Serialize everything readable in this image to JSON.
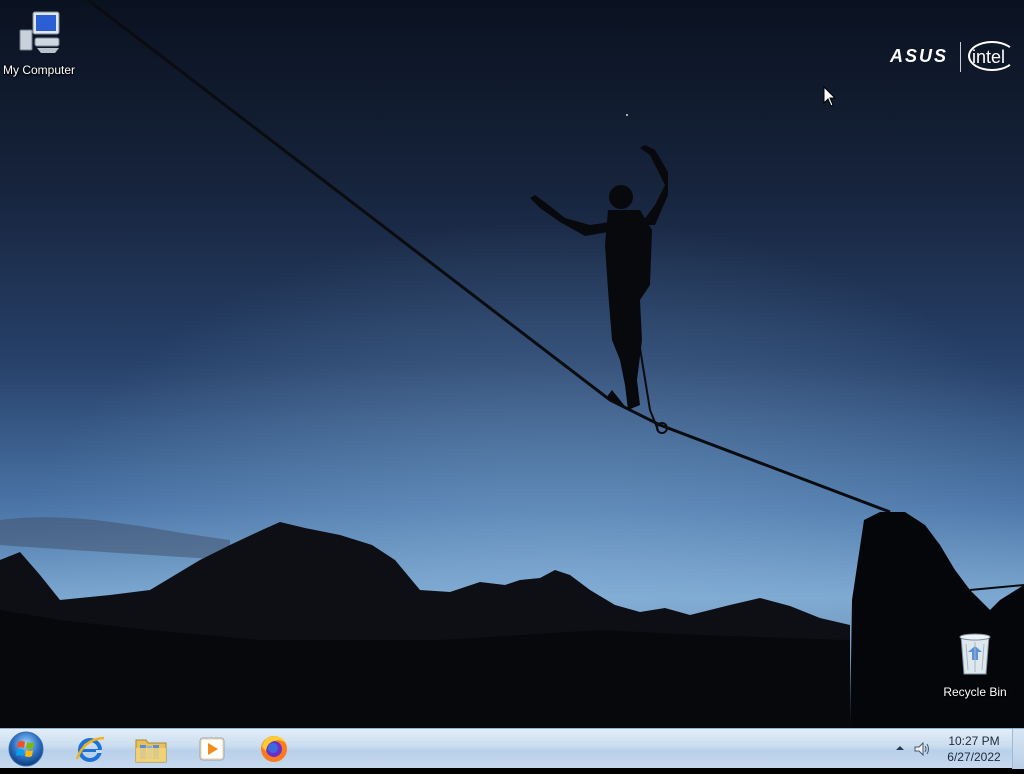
{
  "desktop": {
    "icons": [
      {
        "label": "My Computer",
        "icon": "computer-icon"
      },
      {
        "label": "Recycle Bin",
        "icon": "recycle-bin-icon"
      }
    ],
    "oem_logos": {
      "left": "ASUS",
      "right": "intel"
    }
  },
  "taskbar": {
    "start": {
      "icon": "windows-orb-icon"
    },
    "pinned": [
      {
        "name": "Internet Explorer",
        "icon": "internet-explorer-icon"
      },
      {
        "name": "Windows Explorer",
        "icon": "folder-library-icon"
      },
      {
        "name": "Windows Media Player",
        "icon": "media-player-icon"
      },
      {
        "name": "Firefox",
        "icon": "firefox-icon"
      }
    ],
    "tray": {
      "chevron_icon": "show-hidden-icons-chevron",
      "volume_icon": "speaker-icon",
      "time": "10:27 PM",
      "date": "6/27/2022"
    }
  },
  "colors": {
    "sky_top": "#0b1322",
    "sky_mid": "#2c4a76",
    "sky_horizon": "#7ba6d0",
    "taskbar": "#c9dcef"
  }
}
